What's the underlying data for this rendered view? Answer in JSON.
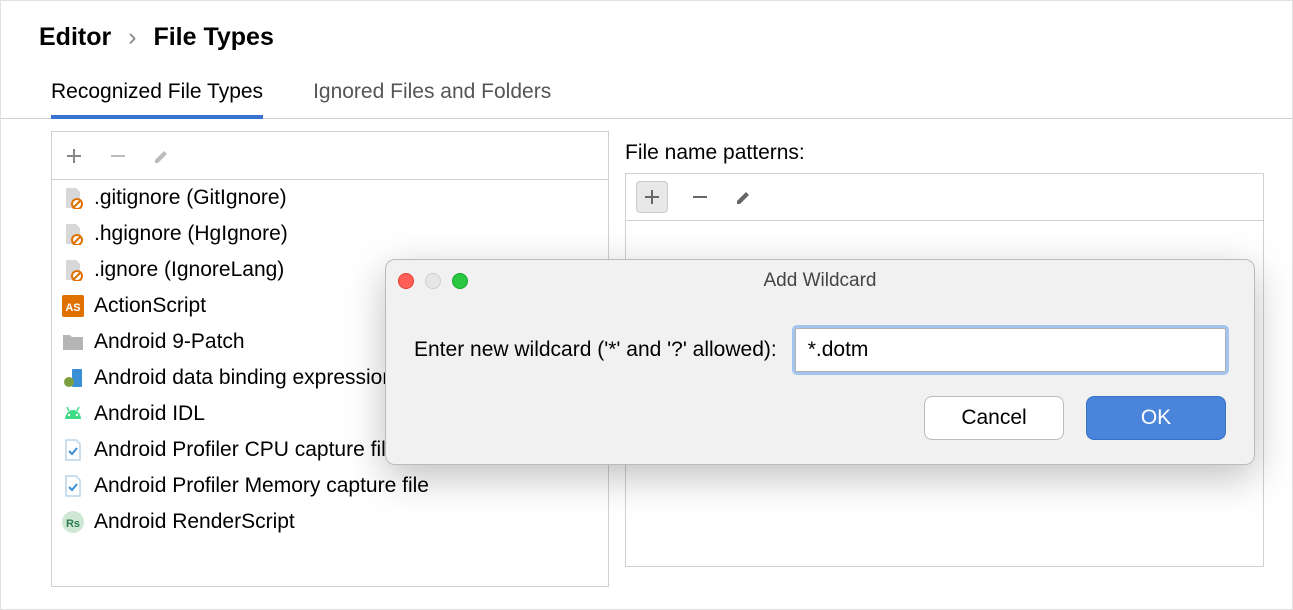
{
  "breadcrumb": {
    "parent": "Editor",
    "current": "File Types"
  },
  "tabs": [
    {
      "label": "Recognized File Types",
      "active": true
    },
    {
      "label": "Ignored Files and Folders",
      "active": false
    }
  ],
  "file_types": [
    {
      "label": ".gitignore (GitIgnore)",
      "icon": "file-ignore"
    },
    {
      "label": ".hgignore (HgIgnore)",
      "icon": "file-ignore"
    },
    {
      "label": ".ignore (IgnoreLang)",
      "icon": "file-ignore"
    },
    {
      "label": "ActionScript",
      "icon": "as"
    },
    {
      "label": "Android 9-Patch",
      "icon": "folder"
    },
    {
      "label": "Android data binding expression",
      "icon": "android-data"
    },
    {
      "label": "Android IDL",
      "icon": "android"
    },
    {
      "label": "Android Profiler CPU capture file",
      "icon": "profiler"
    },
    {
      "label": "Android Profiler Memory capture file",
      "icon": "profiler"
    },
    {
      "label": "Android RenderScript",
      "icon": "rs"
    }
  ],
  "patterns_section": {
    "label": "File name patterns:"
  },
  "dialog": {
    "title": "Add Wildcard",
    "prompt": "Enter new wildcard ('*' and '?' allowed):",
    "input_value": "*.dotm",
    "cancel_label": "Cancel",
    "ok_label": "OK"
  }
}
